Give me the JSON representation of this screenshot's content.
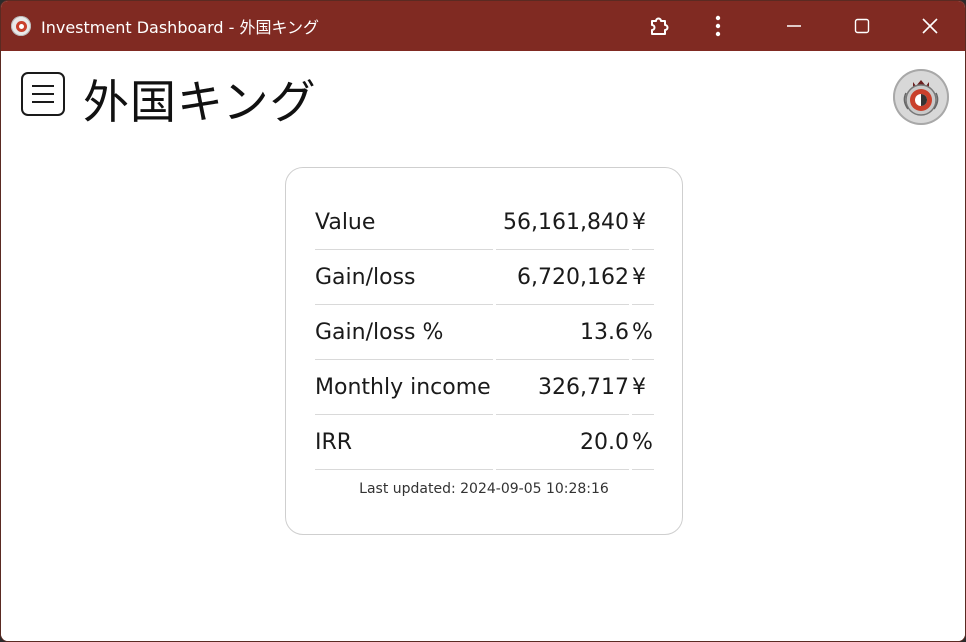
{
  "window": {
    "title": "Investment Dashboard - 外国キング",
    "app_icon": "app-logo-icon",
    "controls": [
      "extensions-icon",
      "more-options-icon",
      "minimize-icon",
      "maximize-icon",
      "close-icon"
    ]
  },
  "header": {
    "menu_icon": "hamburger-menu-icon",
    "title": "外国キング",
    "avatar_icon": "profile-crest-icon"
  },
  "stats": {
    "rows": [
      {
        "label": "Value",
        "value": "56,161,840",
        "unit": "¥"
      },
      {
        "label": "Gain/loss",
        "value": "6,720,162",
        "unit": "¥"
      },
      {
        "label": "Gain/loss %",
        "value": "13.6",
        "unit": "%"
      },
      {
        "label": "Monthly income",
        "value": "326,717",
        "unit": "¥"
      },
      {
        "label": "IRR",
        "value": "20.0",
        "unit": "%"
      }
    ],
    "last_updated": "Last updated: 2024-09-05 10:28:16"
  },
  "colors": {
    "titlebar": "#802a22",
    "accent": "#c9402c"
  }
}
